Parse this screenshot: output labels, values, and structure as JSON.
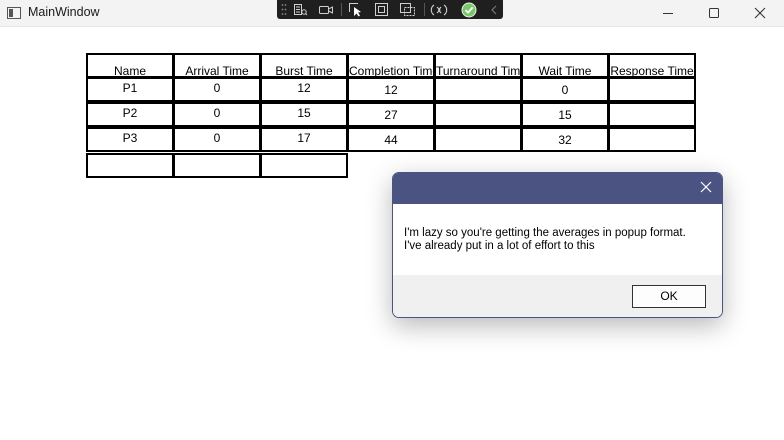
{
  "window": {
    "title": "MainWindow",
    "controls": {
      "minimize_icon": "minimize-icon",
      "maximize_icon": "maximize-icon",
      "close_icon": "close-icon"
    }
  },
  "debug_toolbar": {
    "items": [
      "grip-icon",
      "live-visual-tree-icon",
      "camera-icon",
      "select-element-icon",
      "display-layout-adorners-icon",
      "track-focus-icon",
      "hot-reload-icon",
      "binding-ok-icon",
      "collapse-chevron-icon"
    ]
  },
  "table": {
    "headers": [
      "Name",
      "Arrival Time",
      "Burst Time",
      "Completion Time",
      "Turnaround Time",
      "Wait Time",
      "Response Time"
    ],
    "rows": [
      [
        "P1",
        "0",
        "12",
        "12",
        "",
        "0",
        ""
      ],
      [
        "P2",
        "0",
        "15",
        "27",
        "",
        "15",
        ""
      ],
      [
        "P3",
        "0",
        "17",
        "44",
        "",
        "32",
        ""
      ]
    ],
    "input_row": [
      "",
      "",
      ""
    ]
  },
  "dialog": {
    "title": "",
    "message_line1": "I'm lazy so you're getting the averages in popup format.",
    "message_line2": "I've already put in a lot of effort to this",
    "ok_label": "OK"
  }
}
